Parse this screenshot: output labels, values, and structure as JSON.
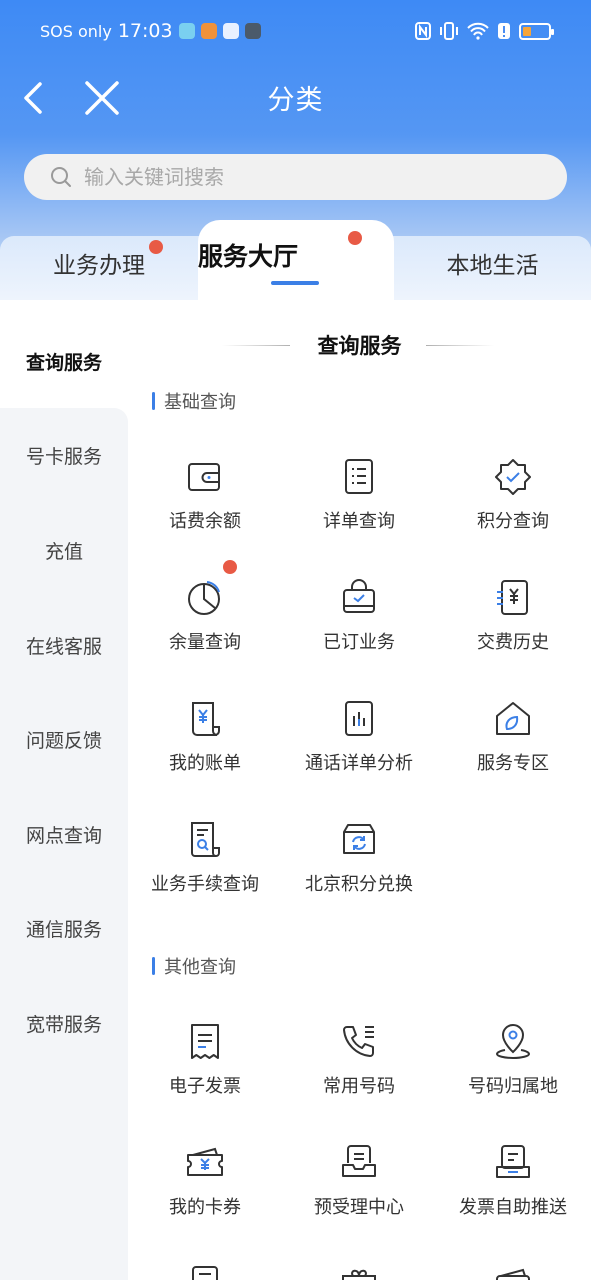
{
  "status_bar": {
    "carrier": "SOS only",
    "time": "17:03"
  },
  "nav": {
    "title": "分类"
  },
  "search": {
    "placeholder": "输入关键词搜索"
  },
  "tabs": [
    {
      "label": "业务办理",
      "dot": true
    },
    {
      "label": "服务大厅",
      "dot": true,
      "active": true
    },
    {
      "label": "本地生活",
      "dot": false
    }
  ],
  "sidebar": {
    "items": [
      {
        "label": "查询服务",
        "active": true
      },
      {
        "label": "号卡服务"
      },
      {
        "label": "充值"
      },
      {
        "label": "在线客服"
      },
      {
        "label": "问题反馈"
      },
      {
        "label": "网点查询"
      },
      {
        "label": "通信服务"
      },
      {
        "label": "宽带服务"
      }
    ]
  },
  "main": {
    "section_title": "查询服务",
    "groups": [
      {
        "title": "基础查询",
        "items": [
          {
            "label": "话费余额",
            "icon": "wallet-icon"
          },
          {
            "label": "详单查询",
            "icon": "list-document-icon"
          },
          {
            "label": "积分查询",
            "icon": "badge-check-icon"
          },
          {
            "label": "余量查询",
            "icon": "pie-chart-icon",
            "dot": true
          },
          {
            "label": "已订业务",
            "icon": "bag-check-icon"
          },
          {
            "label": "交费历史",
            "icon": "yen-receipt-icon"
          },
          {
            "label": "我的账单",
            "icon": "yen-bill-icon"
          },
          {
            "label": "通话详单分析",
            "icon": "bar-chart-document-icon"
          },
          {
            "label": "服务专区",
            "icon": "home-leaf-icon"
          },
          {
            "label": "业务手续查询",
            "icon": "document-search-icon"
          },
          {
            "label": "北京积分兑换",
            "icon": "exchange-box-icon"
          }
        ]
      },
      {
        "title": "其他查询",
        "items": [
          {
            "label": "电子发票",
            "icon": "invoice-icon"
          },
          {
            "label": "常用号码",
            "icon": "phone-list-icon"
          },
          {
            "label": "号码归属地",
            "icon": "location-pin-icon"
          },
          {
            "label": "我的卡券",
            "icon": "yen-ticket-icon"
          },
          {
            "label": "预受理中心",
            "icon": "inbox-document-icon"
          },
          {
            "label": "发票自助推送",
            "icon": "invoice-tray-icon"
          }
        ]
      }
    ]
  },
  "colors": {
    "accent": "#3b7fe6",
    "dot": "#e85a45",
    "icon": "#333333"
  }
}
